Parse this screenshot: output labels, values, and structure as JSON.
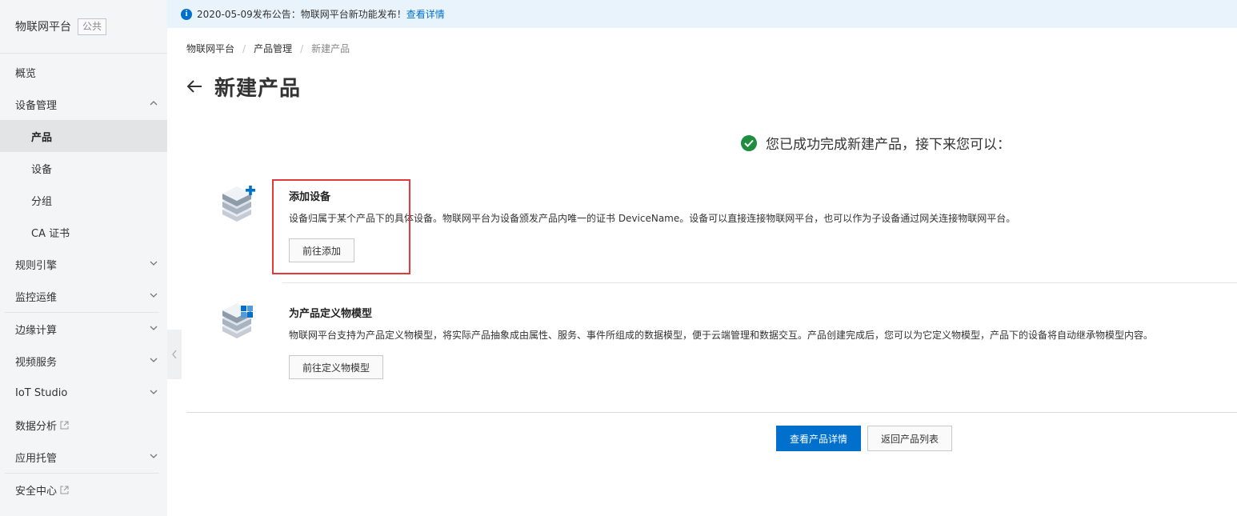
{
  "sidebar": {
    "title": "物联网平台",
    "badge": "公共",
    "items": [
      {
        "label": "概览"
      },
      {
        "label": "设备管理"
      },
      {
        "label": "产品"
      },
      {
        "label": "设备"
      },
      {
        "label": "分组"
      },
      {
        "label": "CA 证书"
      },
      {
        "label": "规则引擎"
      },
      {
        "label": "监控运维"
      },
      {
        "label": "边缘计算"
      },
      {
        "label": "视频服务"
      },
      {
        "label": "IoT Studio"
      },
      {
        "label": "数据分析"
      },
      {
        "label": "应用托管"
      },
      {
        "label": "安全中心"
      }
    ]
  },
  "notice": {
    "text": "2020-05-09发布公告：物联网平台新功能发布！",
    "link": "查看详情"
  },
  "breadcrumb": [
    "物联网平台",
    "产品管理",
    "新建产品"
  ],
  "page_title": "新建产品",
  "success_message": "您已成功完成新建产品，接下来您可以：",
  "steps": [
    {
      "title": "添加设备",
      "desc": "设备归属于某个产品下的具体设备。物联网平台为设备颁发产品内唯一的证书 DeviceName。设备可以直接连接物联网平台，也可以作为子设备通过网关连接物联网平台。",
      "button": "前往添加"
    },
    {
      "title": "为产品定义物模型",
      "desc": "物联网平台支持为产品定义物模型，将实际产品抽象成由属性、服务、事件所组成的数据模型，便于云端管理和数据交互。产品创建完成后，您可以为它定义物模型，产品下的设备将自动继承物模型内容。",
      "button": "前往定义物模型"
    }
  ],
  "footer": {
    "primary_button": "查看产品详情",
    "secondary_button": "返回产品列表"
  },
  "colors": {
    "primary": "#0070cc",
    "success": "#1e8e3e",
    "highlight_box": "#e03a3a",
    "sidebar_bg": "#f4f5f7",
    "notice_bg": "#e9f3fb"
  }
}
